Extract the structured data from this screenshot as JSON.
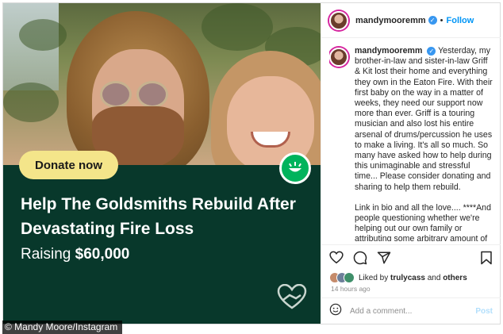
{
  "header": {
    "username": "mandymooremm",
    "follow_label": "Follow",
    "separator": "•"
  },
  "media": {
    "donate_label": "Donate now",
    "headline": "Help The Goldsmiths Rebuild After Devastating Fire Loss",
    "raising_label": "Raising",
    "raising_amount": "$60,000",
    "panel_color": "#08382b",
    "button_color": "#f4e58a",
    "badge_color": "#00b35c"
  },
  "caption": {
    "username": "mandymooremm",
    "paragraph1": "Yesterday, my brother-in-law and sister-in-law Griff & Kit lost their home and everything they own in the Eaton Fire. With their first baby on the way in a matter of weeks, they need our support now more than ever. Griff is a touring musician and also lost his entire arsenal of drums/percussion he uses to make a living. It's all so much. So many have asked how to help during this unimaginable and stressful time... Please consider donating and sharing to help them rebuild.",
    "paragraph2": "Link in bio and all the love.... ****And people questioning whether we're helping out our own family or attributing some arbitrary amount of money google says someone has is"
  },
  "actions": {
    "icons": [
      "heart-icon",
      "comment-icon",
      "share-icon",
      "bookmark-icon"
    ]
  },
  "likes": {
    "prefix": "Liked by",
    "user": "trulycass",
    "conjunction": "and",
    "others": "others"
  },
  "timestamp": "14 hours ago",
  "comment_box": {
    "placeholder": "Add a comment...",
    "post_label": "Post"
  },
  "credit": "© Mandy Moore/Instagram"
}
